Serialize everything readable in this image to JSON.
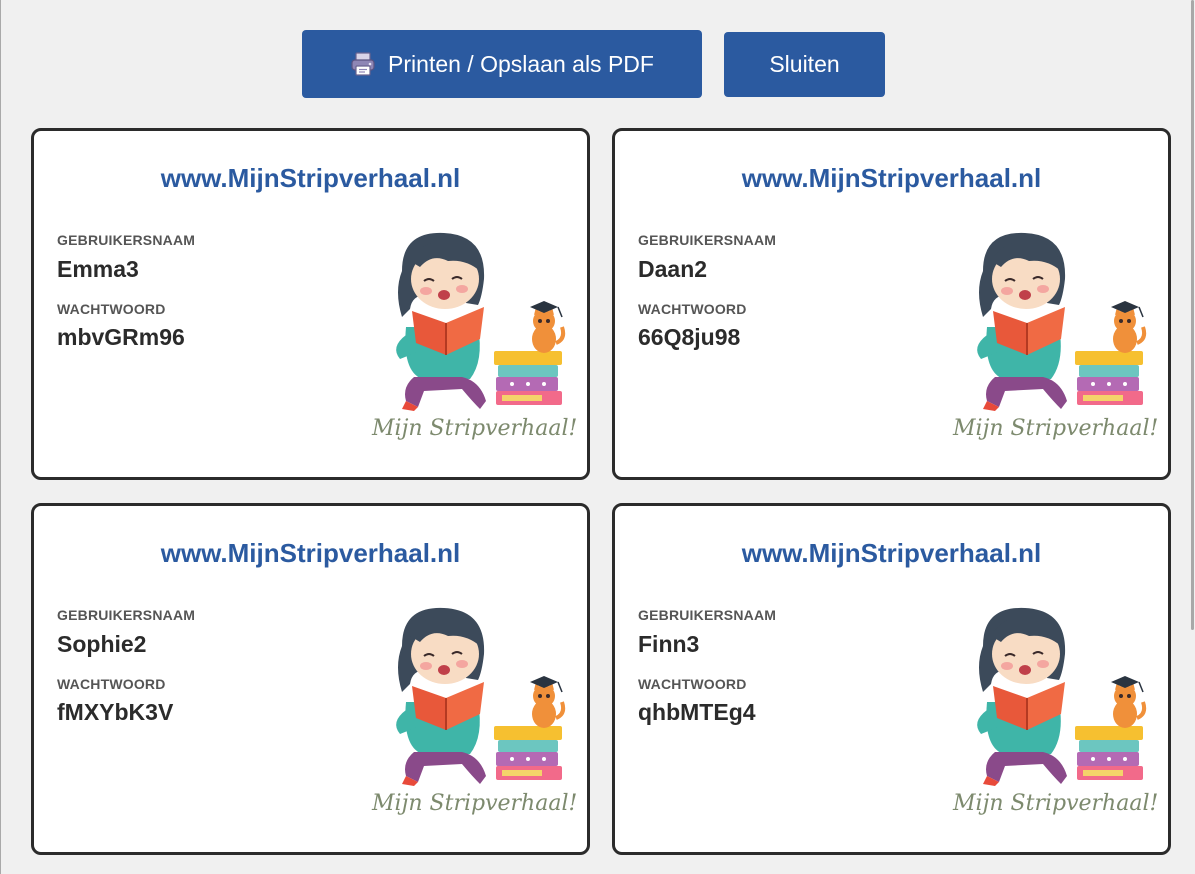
{
  "toolbar": {
    "print_label": "Printen / Opslaan als PDF",
    "print_icon": "printer-icon",
    "close_label": "Sluiten"
  },
  "cards": [
    {
      "url": "www.MijnStripverhaal.nl",
      "username_label": "GEBRUIKERSNAAM",
      "username": "Emma3",
      "password_label": "WACHTWOORD",
      "password": "mbvGRm96",
      "logo_text": "Mijn Stripverhaal!"
    },
    {
      "url": "www.MijnStripverhaal.nl",
      "username_label": "GEBRUIKERSNAAM",
      "username": "Daan2",
      "password_label": "WACHTWOORD",
      "password": "66Q8ju98",
      "logo_text": "Mijn Stripverhaal!"
    },
    {
      "url": "www.MijnStripverhaal.nl",
      "username_label": "GEBRUIKERSNAAM",
      "username": "Sophie2",
      "password_label": "WACHTWOORD",
      "password": "fMXYbK3V",
      "logo_text": "Mijn Stripverhaal!"
    },
    {
      "url": "www.MijnStripverhaal.nl",
      "username_label": "GEBRUIKERSNAAM",
      "username": "Finn3",
      "password_label": "WACHTWOORD",
      "password": "qhbMTEg4",
      "logo_text": "Mijn Stripverhaal!"
    }
  ],
  "colors": {
    "accent": "#2b5aa0",
    "card_border": "#2b2b2b",
    "background": "#f0f0f0"
  }
}
